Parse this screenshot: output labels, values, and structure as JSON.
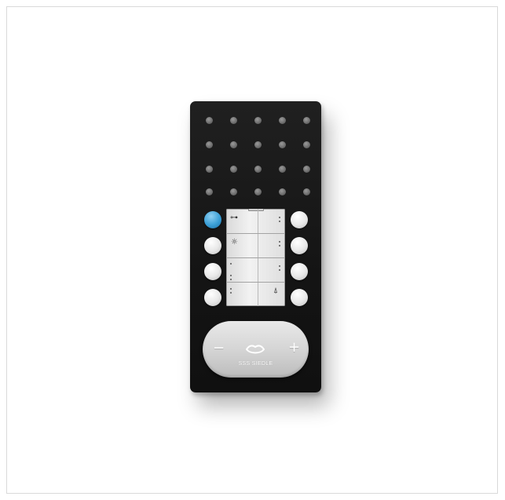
{
  "device": {
    "brand": "SSS SIEDLE",
    "colors": {
      "housing": "#151515",
      "buttons": "#e9e9e9",
      "door_button": "#3a9fd6",
      "speaker_holes": "#707070"
    },
    "label_strip": {
      "icons": [
        "key-icon",
        "light-icon",
        "bell-mute-icon"
      ],
      "key_symbol": "⊶",
      "light_symbol": "☼",
      "bell_symbol": "⍋"
    },
    "handsfree_pad": {
      "minus": "−",
      "plus": "+",
      "speak_symbol": "⌓"
    }
  }
}
